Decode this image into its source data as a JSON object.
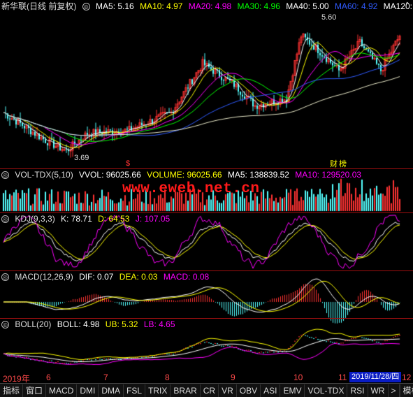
{
  "main": {
    "title": "新华联(日线 前复权)",
    "ma": [
      {
        "label": "MA5: 5.16",
        "color": "#ffffff"
      },
      {
        "label": "MA10: 4.97",
        "color": "#ffff00"
      },
      {
        "label": "MA20: 4.98",
        "color": "#ff00ff"
      },
      {
        "label": "MA30: 4.96",
        "color": "#00ff00"
      },
      {
        "label": "MA40: 5.00",
        "color": "#ffffff"
      },
      {
        "label": "MA60: 4.92",
        "color": "#2f5bff"
      },
      {
        "label": "MA120:",
        "color": "#ffffff"
      }
    ],
    "high_label": "5.60",
    "low_label": "3.69",
    "cai_label": "财",
    "bang_label": "榜",
    "s_label": "$"
  },
  "vol": {
    "title": "VOL-TDX(5,10)",
    "items": [
      {
        "label": "VVOL: 96025.66",
        "color": "#ffffff"
      },
      {
        "label": "VOLUME: 96025.66",
        "color": "#ffff00"
      },
      {
        "label": "MA5: 138839.52",
        "color": "#ffffff"
      },
      {
        "label": "MA10: 129520.03",
        "color": "#ff00ff"
      }
    ]
  },
  "kdj": {
    "title": "KDJ(9,3,3)",
    "items": [
      {
        "label": "K: 78.71",
        "color": "#ffffff"
      },
      {
        "label": "D: 64.53",
        "color": "#ffff00"
      },
      {
        "label": "J: 107.05",
        "color": "#ff00ff"
      }
    ]
  },
  "macd": {
    "title": "MACD(12,26,9)",
    "items": [
      {
        "label": "DIF: 0.07",
        "color": "#ffffff"
      },
      {
        "label": "DEA: 0.03",
        "color": "#ffff00"
      },
      {
        "label": "MACD: 0.08",
        "color": "#ff00ff"
      }
    ]
  },
  "boll": {
    "title": "BOLL(20)",
    "items": [
      {
        "label": "BOLL: 4.98",
        "color": "#ffffff"
      },
      {
        "label": "UB: 5.32",
        "color": "#ffff00"
      },
      {
        "label": "LB: 4.65",
        "color": "#ff00ff"
      }
    ]
  },
  "watermark": "www.eweb.net.cn",
  "axis_labels": [
    "2019年",
    "6",
    "7",
    "8",
    "9",
    "10",
    "11",
    "12"
  ],
  "date_box": "2019/11/28/四",
  "tabs": [
    "指标",
    "窗口",
    "MACD",
    "DMI",
    "DMA",
    "FSL",
    "TRIX",
    "BRAR",
    "CR",
    "VR",
    "OBV",
    "ASI",
    "EMV",
    "VOL-TDX",
    "RSI",
    "WR",
    ">"
  ],
  "tab_right": "模板",
  "colors": {
    "up": "#ff3232",
    "down": "#54ffff",
    "grid": "#800000"
  }
}
